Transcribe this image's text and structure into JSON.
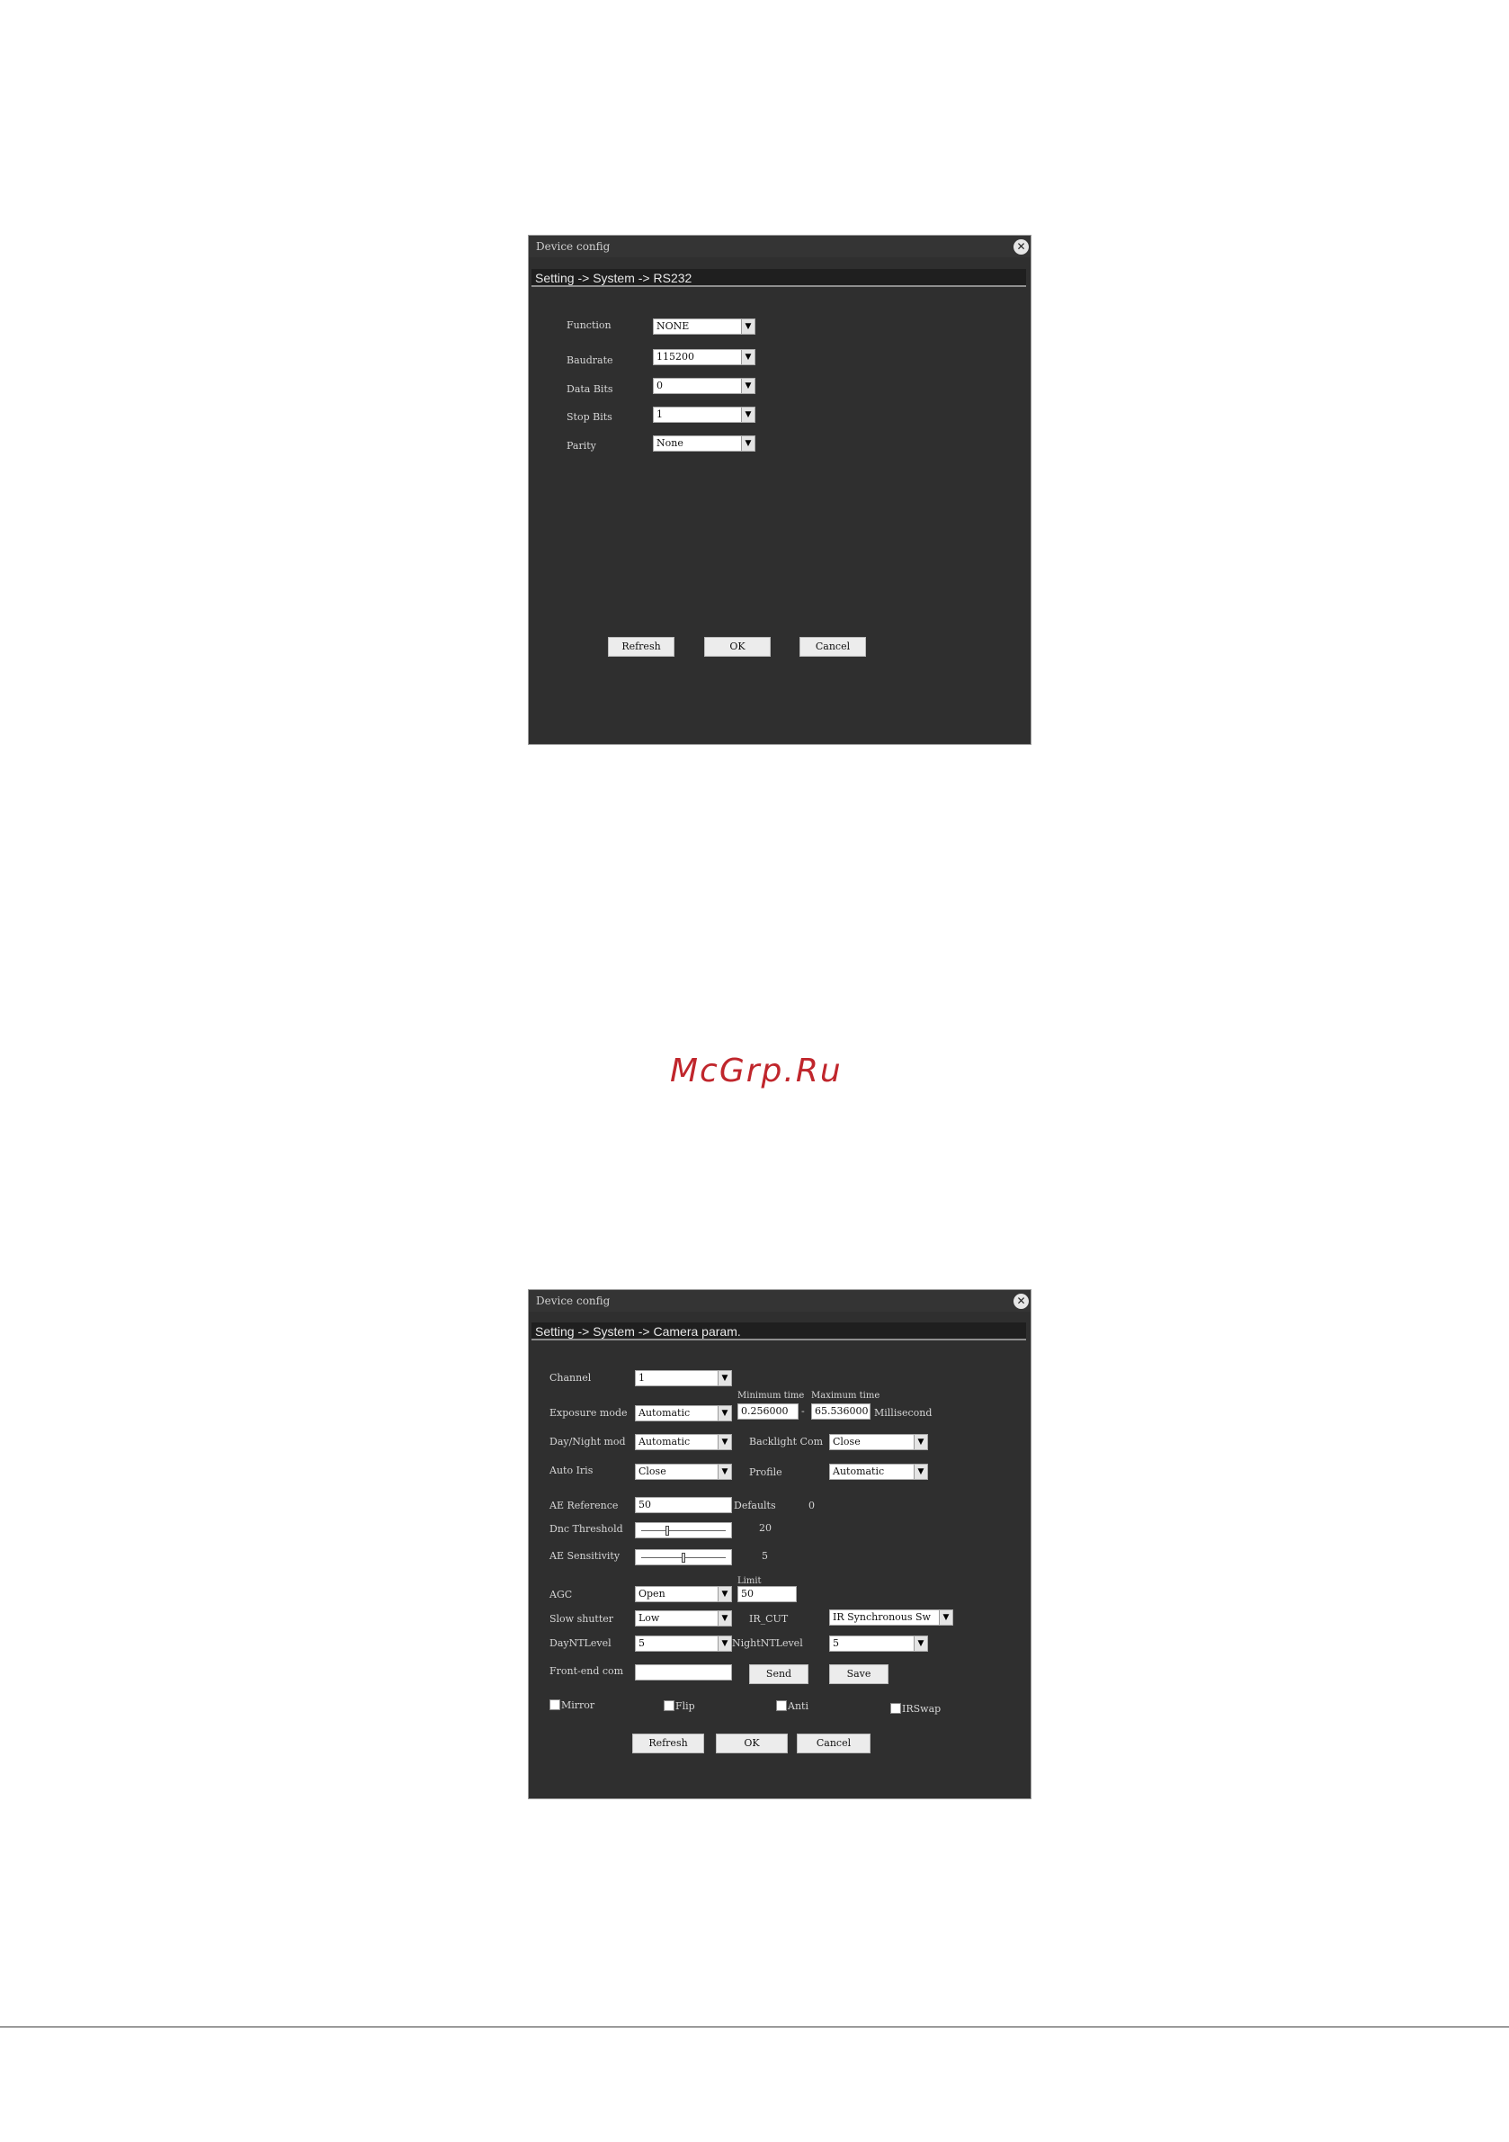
{
  "win1": {
    "title": "Device config",
    "breadcrumb": "Setting -> System -> RS232",
    "function_label": "Function",
    "function_value": "NONE",
    "baudrate_label": "Baudrate",
    "baudrate_value": "115200",
    "databits_label": "Data Bits",
    "databits_value": "0",
    "stopbits_label": "Stop Bits",
    "stopbits_value": "1",
    "parity_label": "Parity",
    "parity_value": "None",
    "refresh": "Refresh",
    "ok": "OK",
    "cancel": "Cancel"
  },
  "win2": {
    "title": "Device config",
    "breadcrumb": "Setting -> System -> Camera param.",
    "channel_label": "Channel",
    "channel_value": "1",
    "min_time_label": "Minimum time",
    "max_time_label": "Maximum time",
    "exposure_label": "Exposure mode",
    "exposure_value": "Automatic",
    "min_time_value": "0.256000",
    "dash": "-",
    "max_time_value": "65.536000",
    "ms_label": "Millisecond",
    "daynight_label": "Day/Night mod",
    "daynight_value": "Automatic",
    "backlight_label": "Backlight Com",
    "backlight_value": "Close",
    "autoiris_label": "Auto Iris",
    "autoiris_value": "Close",
    "profile_label": "Profile",
    "profile_value": "Automatic",
    "aeref_label": "AE Reference",
    "aeref_value": "50",
    "defaults_label": "Defaults",
    "defaults_value": "0",
    "dnc_label": "Dnc Threshold",
    "dnc_value": "20",
    "aesens_label": "AE Sensitivity",
    "aesens_value": "5",
    "agc_label": "AGC",
    "agc_value": "Open",
    "limit_label": "Limit",
    "limit_value": "50",
    "slowshutter_label": "Slow shutter",
    "slowshutter_value": "Low",
    "ircut_label": "IR_CUT",
    "ircut_value": "IR Synchronous Sw",
    "daynt_label": "DayNTLevel",
    "daynt_value": "5",
    "nightnt_label": "NightNTLevel",
    "nightnt_value": "5",
    "frontend_label": "Front-end com",
    "frontend_value": "",
    "send": "Send",
    "save": "Save",
    "mirror": "Mirror",
    "flip": "Flip",
    "anti": "Anti",
    "irswap": "IRSwap",
    "refresh": "Refresh",
    "ok": "OK",
    "cancel": "Cancel",
    "dnc_slider_fraction": 0.3,
    "aesens_slider_fraction": 0.5
  },
  "watermark": "McGrp.Ru",
  "icons": {
    "close": "close-icon",
    "dropdown": "chevron-down-icon"
  }
}
